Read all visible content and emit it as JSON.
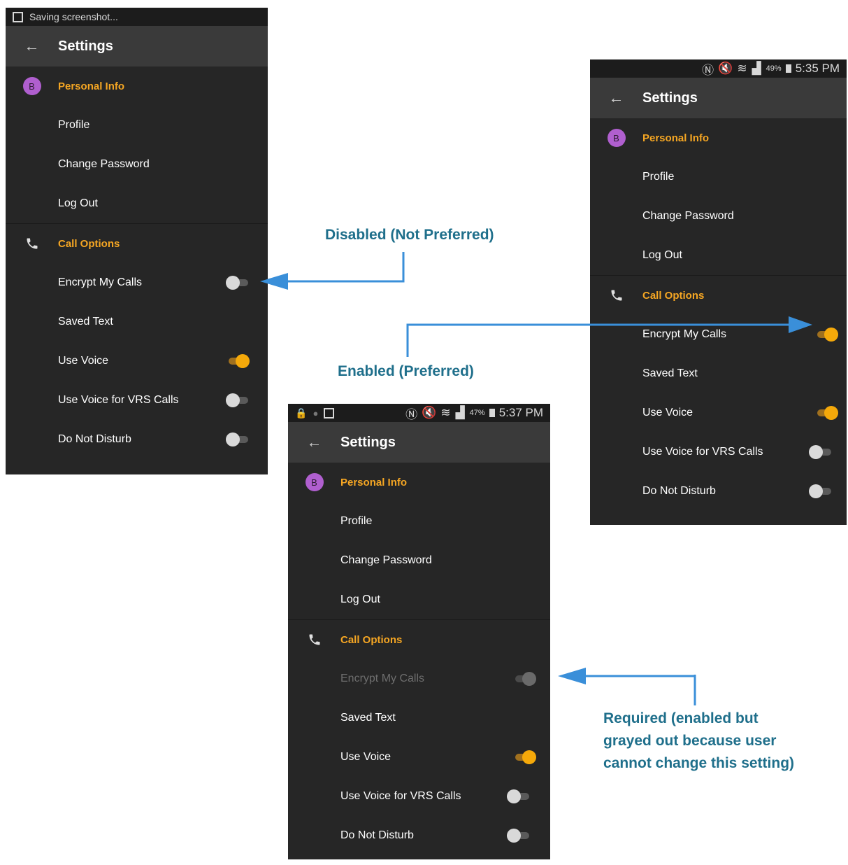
{
  "phone1": {
    "status": {
      "text": "Saving screenshot..."
    },
    "header": {
      "back_icon": "back-arrow-icon",
      "title": "Settings"
    },
    "personal": {
      "avatar": "B",
      "title": "Personal Info",
      "items": [
        "Profile",
        "Change Password",
        "Log Out"
      ]
    },
    "call": {
      "title": "Call Options",
      "items": [
        {
          "label": "Encrypt My Calls",
          "toggle": "off"
        },
        {
          "label": "Saved Text",
          "toggle": "none"
        },
        {
          "label": "Use Voice",
          "toggle": "on"
        },
        {
          "label": "Use Voice for VRS Calls",
          "toggle": "off"
        },
        {
          "label": "Do Not Disturb",
          "toggle": "off"
        }
      ]
    }
  },
  "phone2": {
    "status": {
      "battery": "49%",
      "time": "5:35 PM"
    },
    "header": {
      "back_icon": "back-arrow-icon",
      "title": "Settings"
    },
    "personal": {
      "avatar": "B",
      "title": "Personal Info",
      "items": [
        "Profile",
        "Change Password",
        "Log Out"
      ]
    },
    "call": {
      "title": "Call Options",
      "items": [
        {
          "label": "Encrypt My Calls",
          "toggle": "on"
        },
        {
          "label": "Saved Text",
          "toggle": "none"
        },
        {
          "label": "Use Voice",
          "toggle": "on"
        },
        {
          "label": "Use Voice for VRS Calls",
          "toggle": "off"
        },
        {
          "label": "Do Not Disturb",
          "toggle": "off"
        }
      ]
    }
  },
  "phone3": {
    "status": {
      "battery": "47%",
      "time": "5:37 PM"
    },
    "header": {
      "back_icon": "back-arrow-icon",
      "title": "Settings"
    },
    "personal": {
      "avatar": "B",
      "title": "Personal Info",
      "items": [
        "Profile",
        "Change Password",
        "Log Out"
      ]
    },
    "call": {
      "title": "Call Options",
      "items": [
        {
          "label": "Encrypt My Calls",
          "toggle": "locked"
        },
        {
          "label": "Saved Text",
          "toggle": "none"
        },
        {
          "label": "Use Voice",
          "toggle": "on"
        },
        {
          "label": "Use Voice for VRS Calls",
          "toggle": "off"
        },
        {
          "label": "Do Not Disturb",
          "toggle": "off"
        }
      ]
    }
  },
  "annotations": {
    "disabled": "Disabled (Not Preferred)",
    "enabled": "Enabled (Preferred)",
    "required_line1": "Required (enabled but",
    "required_line2": "grayed out because user",
    "required_line3": "cannot change this setting)"
  },
  "colors": {
    "accent": "#f5a623",
    "annotation": "#1f6f8b",
    "arrow": "#3a8fd9",
    "panel": "#262626",
    "toolbar": "#3a3a3a"
  }
}
